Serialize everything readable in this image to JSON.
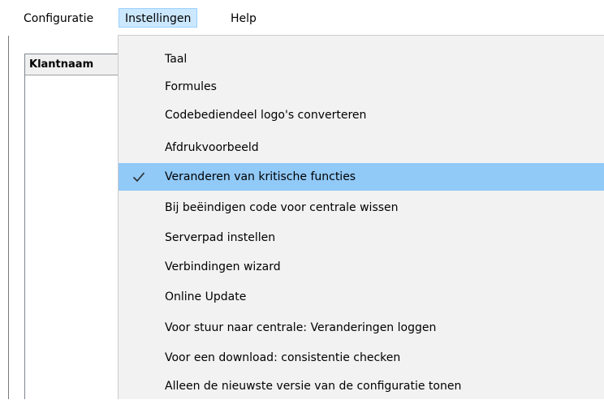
{
  "menubar": {
    "items": [
      {
        "label": "Configuratie"
      },
      {
        "label": "Instellingen"
      },
      {
        "label": "Help"
      }
    ]
  },
  "list": {
    "column_header": "Klantnaam"
  },
  "instellingen_menu": {
    "items": [
      {
        "label": "Taal",
        "checked": false
      },
      {
        "label": "Formules",
        "checked": false
      },
      {
        "label": "Codebediendeel logo's converteren",
        "checked": false
      },
      {
        "label": "Afdrukvoorbeeld",
        "checked": false
      },
      {
        "label": "Veranderen van kritische functies",
        "checked": true,
        "highlighted": true
      },
      {
        "label": "Bij beëindigen code voor centrale wissen",
        "checked": false
      },
      {
        "label": "Serverpad instellen",
        "checked": false
      },
      {
        "label": "Verbindingen wizard",
        "checked": false
      },
      {
        "label": "Online Update",
        "checked": false
      },
      {
        "label": "Voor stuur naar centrale: Veranderingen loggen",
        "checked": false
      },
      {
        "label": "Voor een download: consistentie checken",
        "checked": false
      },
      {
        "label": "Alleen de nieuwste versie van de configuratie tonen",
        "checked": false
      }
    ]
  },
  "icons": {
    "checkmark": "check-icon"
  },
  "colors": {
    "highlight": "#91c9f7",
    "open_menu_bg": "#cce8ff",
    "menu_bg": "#f2f2f2"
  }
}
